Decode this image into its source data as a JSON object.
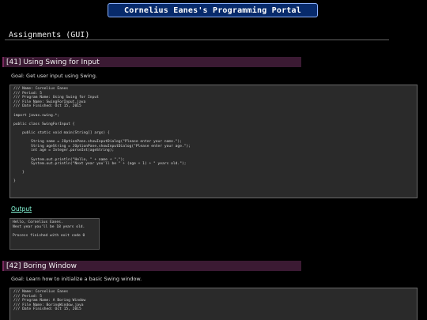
{
  "header": {
    "title": "Cornelius Eanes's Programming Portal"
  },
  "page": {
    "heading": "Assignments (GUI)"
  },
  "sections": [
    {
      "title": "[41] Using Swing for Input",
      "goal": "Goal: Get user input using Swing.",
      "code": [
        "/// Name: Cornelius Eanes",
        "/// Period: 5",
        "/// Program Name: Using Swing for Input",
        "/// File Name: SwingForInput.java",
        "/// Date Finished: Oct 15, 2015",
        "",
        "import javax.swing.*;",
        "",
        "public class SwingForInput {",
        "",
        "    public static void main(String[] args) {",
        "",
        "        String name = JOptionPane.showInputDialog(\"Please enter your name.\");",
        "        String ageString = JOptionPane.showInputDialog(\"Please enter your age.\");",
        "        int age = Integer.parseInt(ageString);",
        "",
        "        System.out.println(\"Hello, \" + name + \".\");",
        "        System.out.println(\"Next year you'll be \" + (age + 1) + \" years old.\");",
        "",
        "    }",
        "",
        "}"
      ],
      "output_label": "Output",
      "output": [
        "Hello, Cornelius Eanes.",
        "Next year you'll be 18 years old.",
        "",
        "Process finished with exit code 0"
      ]
    },
    {
      "title": "[42] Boring Window",
      "goal": "Goal: Learn how to initialize a basic Swing window.",
      "code": [
        "/// Name: Cornelius Eanes",
        "/// Period: 5",
        "/// Program Name: A Boring Window",
        "/// File Name: BoringWindow.java",
        "/// Date Finished: Oct 15, 2015"
      ]
    }
  ]
}
